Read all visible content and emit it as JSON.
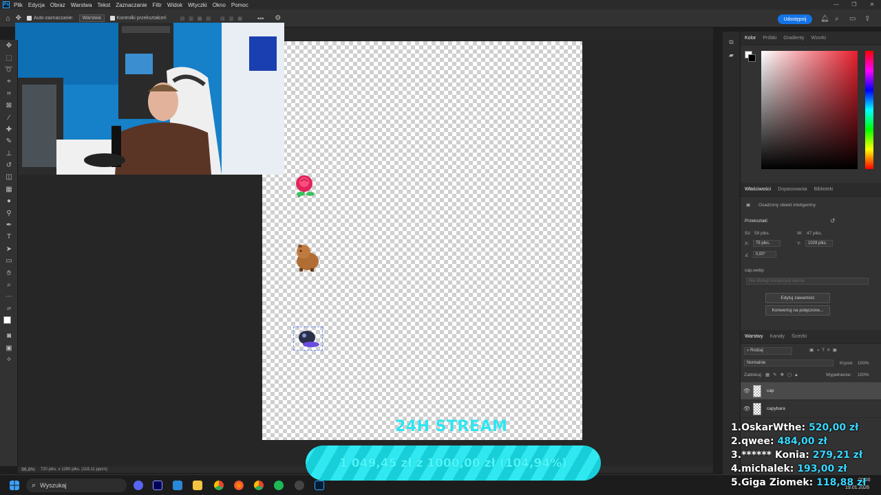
{
  "menubar": {
    "logo": "Ps",
    "items": [
      "Plik",
      "Edycja",
      "Obraz",
      "Warstwa",
      "Tekst",
      "Zaznaczanie",
      "Filtr",
      "Widok",
      "Wtyczki",
      "Okno",
      "Pomoc"
    ]
  },
  "optionsbar": {
    "auto_select": "Auto-zaznaczanie:",
    "auto_select_value": "Warstwa",
    "transform_controls": "Kontrolki przekształceń",
    "more": "•••",
    "share": "Udostępnij"
  },
  "right_panel": {
    "color_tabs": [
      "Kolor",
      "Próbki",
      "Gradienty",
      "Wzorki"
    ],
    "props_tabs": [
      "Właściwości",
      "Dopasowania",
      "Biblioteki"
    ],
    "smart_object": "Osadzony obiekt inteligentny",
    "transform_title": "Przekształć",
    "w_label": "Sz:",
    "w_value": "59 piks.",
    "h_label": "W:",
    "h_value": "47 piks.",
    "x_label": "X:",
    "x_value": "75 piks.",
    "y_label": "Y:",
    "y_value": "1029 piks.",
    "angle_value": "0,00°",
    "filename": "cap.webp",
    "comp_placeholder": "Nie obsługi kompozycji warstw",
    "edit_button": "Edytuj zawartość",
    "convert_button": "Konwertuj na połączone...",
    "layers_tabs": [
      "Warstwy",
      "Kanały",
      "Ścieżki"
    ],
    "kind": "Rodzaj",
    "blend_mode": "Normalnie",
    "opacity_label": "Krycie:",
    "opacity_value": "100%",
    "lock_label": "Zablokuj:",
    "fill_label": "Wypełnienie:",
    "fill_value": "100%",
    "layers": [
      "cap",
      "capybara"
    ]
  },
  "status": {
    "zoom": "96,8%",
    "doc_info": "720 piks. x 1280 piks. (118,11 ppcm)"
  },
  "overlay": {
    "title": "24H STREAM",
    "progress_text": "1 049,45 zł z 1000,00 zł (104,94%)",
    "progress_fraction": 1.0494,
    "leaderboard": [
      {
        "rank": "1.",
        "name": "OskarWthe:",
        "amount": "520,00 zł"
      },
      {
        "rank": "2.",
        "name": "qwee:",
        "amount": "484,00 zł"
      },
      {
        "rank": "3.",
        "name": "****** Konia:",
        "amount": "279,21 zł"
      },
      {
        "rank": "4.",
        "name": "michalek:",
        "amount": "193,00 zł"
      },
      {
        "rank": "5.",
        "name": "Giga Ziomek:",
        "amount": "118,88 zł"
      }
    ]
  },
  "taskbar": {
    "search": "Wyszukaj",
    "time": "00:50",
    "date": "19.01.2026"
  }
}
